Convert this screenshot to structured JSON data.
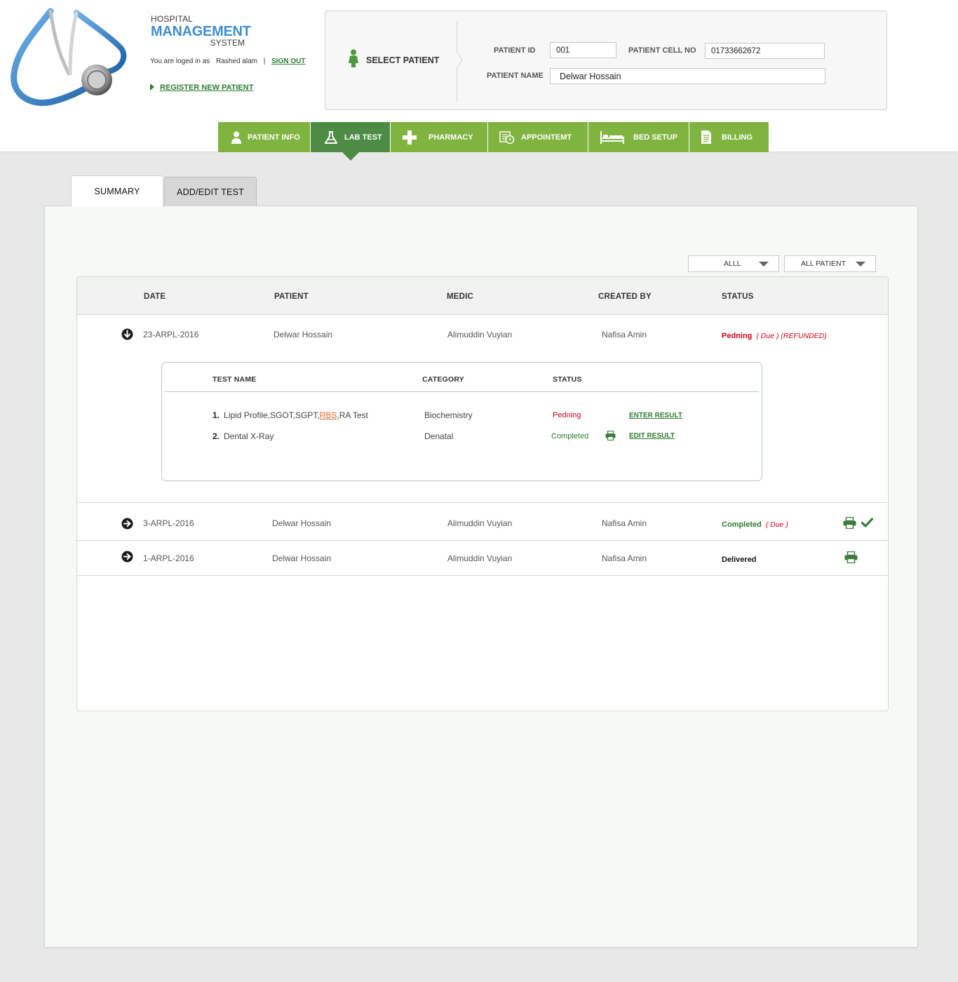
{
  "brand": {
    "line1": "HOSPITAL",
    "line2": "MANAGEMENT",
    "line3": "SYSTEM"
  },
  "session": {
    "logged_prefix": "You are loged in as",
    "user": "Rashed alam",
    "separator": "|",
    "signout": "SIGN OUT"
  },
  "register_link": "REGISTER NEW PATIENT",
  "patient_select": {
    "title": "SELECT PATIENT",
    "id_label": "PATIENT ID",
    "id_value": "001",
    "cell_label": "PATIENT CELL NO",
    "cell_value": "01733662672",
    "name_label": "PATIENT NAME",
    "name_value": "Delwar Hossain"
  },
  "nav": [
    {
      "label": "PATIENT INFO",
      "icon": "person-icon"
    },
    {
      "label": "LAB TEST",
      "icon": "flask-icon",
      "active": true
    },
    {
      "label": "PHARMACY",
      "icon": "cross-icon"
    },
    {
      "label": "APPOINTEMT",
      "icon": "calendar-clock-icon"
    },
    {
      "label": "BED SETUP",
      "icon": "bed-icon"
    },
    {
      "label": "BILLING",
      "icon": "document-icon"
    }
  ],
  "tabs": {
    "summary": "SUMMARY",
    "add_edit": "ADD/EDIT  TEST",
    "active": "summary"
  },
  "filters": {
    "type": "ALLL",
    "patient": "ALL PATIENT"
  },
  "table": {
    "headers": {
      "date": "DATE",
      "patient": "PATIENT",
      "medic": "MEDIC",
      "created_by": "CREATED BY",
      "status": "STATUS"
    },
    "rows": [
      {
        "date": "23-ARPL-2016",
        "patient": "Delwar Hossain",
        "medic": "Alimuddin Vuyian",
        "created_by": "Nafisa Amin",
        "status": "Pedning",
        "status_extra": "( Due ) (REFUNDED)",
        "expanded": true,
        "toggle_icon": "arrow-down-circle-icon",
        "tests": {
          "headers": {
            "name": "TEST NAME",
            "category": "CATEGORY",
            "status": "STATUS"
          },
          "items": [
            {
              "num": "1.",
              "name_before": "Lipid Profile,SGOT,SGPT,",
              "name_highlight": "RBS",
              "name_after": ",RA Test",
              "category": "Biochemistry",
              "status": "Pedning",
              "action": "ENTER RESULT"
            },
            {
              "num": "2.",
              "name_before": "Dental X-Ray",
              "name_highlight": "",
              "name_after": "",
              "category": "Denatal",
              "status": "Completed",
              "action": "EDIT RESULT",
              "print_icon": "printer-icon"
            }
          ]
        }
      },
      {
        "date": "3-ARPL-2016",
        "patient": "Delwar Hossain",
        "medic": "Alimuddin Vuyian",
        "created_by": "Nafisa Amin",
        "status": "Completed",
        "status_extra": "( Due )",
        "toggle_icon": "arrow-right-circle-icon",
        "actions": [
          "printer-icon",
          "checkmark-icon"
        ]
      },
      {
        "date": "1-ARPL-2016",
        "patient": "Delwar Hossain",
        "medic": "Alimuddin Vuyian",
        "created_by": "Nafisa Amin",
        "status": "Delivered",
        "status_extra": "",
        "toggle_icon": "arrow-right-circle-icon",
        "actions": [
          "printer-icon"
        ]
      }
    ]
  },
  "colors": {
    "nav_green": "#80b441",
    "nav_active": "#4c8c45",
    "pending_red": "#d0021b",
    "completed_green": "#2e7d32",
    "brand_blue": "#3e8fd0"
  }
}
